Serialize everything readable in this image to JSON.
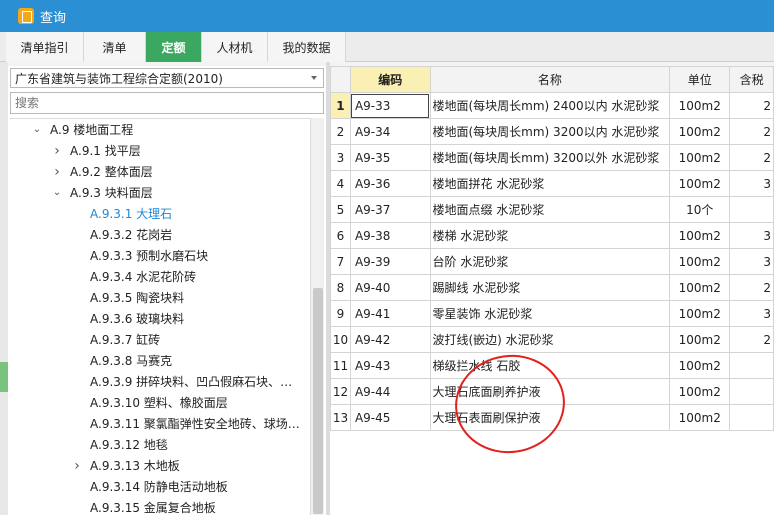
{
  "window": {
    "title": "查询"
  },
  "tabs": [
    {
      "label": "清单指引",
      "active": false
    },
    {
      "label": "清单",
      "active": false
    },
    {
      "label": "定额",
      "active": true
    },
    {
      "label": "人材机",
      "active": false
    },
    {
      "label": "我的数据",
      "active": false
    }
  ],
  "left_panel": {
    "quota_library": "广东省建筑与装饰工程综合定额(2010)",
    "search_placeholder": "搜索",
    "tree": [
      {
        "label": "A.9  楼地面工程",
        "indent": 0,
        "expander": "expanded"
      },
      {
        "label": "A.9.1 找平层",
        "indent": 1,
        "expander": "collapsed"
      },
      {
        "label": "A.9.2 整体面层",
        "indent": 1,
        "expander": "collapsed"
      },
      {
        "label": "A.9.3 块料面层",
        "indent": 1,
        "expander": "expanded"
      },
      {
        "label": "A.9.3.1 大理石",
        "indent": 2,
        "expander": "none",
        "selected": true
      },
      {
        "label": "A.9.3.2 花岗岩",
        "indent": 2,
        "expander": "none"
      },
      {
        "label": "A.9.3.3 预制水磨石块",
        "indent": 2,
        "expander": "none"
      },
      {
        "label": "A.9.3.4 水泥花阶砖",
        "indent": 2,
        "expander": "none"
      },
      {
        "label": "A.9.3.5 陶瓷块料",
        "indent": 2,
        "expander": "none"
      },
      {
        "label": "A.9.3.6 玻璃块料",
        "indent": 2,
        "expander": "none"
      },
      {
        "label": "A.9.3.7 缸砖",
        "indent": 2,
        "expander": "none"
      },
      {
        "label": "A.9.3.8 马赛克",
        "indent": 2,
        "expander": "none"
      },
      {
        "label": "A.9.3.9 拼碎块料、凹凸假麻石块、…",
        "indent": 2,
        "expander": "none"
      },
      {
        "label": "A.9.3.10 塑料、橡胶面层",
        "indent": 2,
        "expander": "none"
      },
      {
        "label": "A.9.3.11 聚氯酯弹性安全地砖、球场…",
        "indent": 2,
        "expander": "none"
      },
      {
        "label": "A.9.3.12 地毯",
        "indent": 2,
        "expander": "none"
      },
      {
        "label": "A.9.3.13 木地板",
        "indent": 2,
        "expander": "collapsed"
      },
      {
        "label": "A.9.3.14 防静电活动地板",
        "indent": 2,
        "expander": "none"
      },
      {
        "label": "A.9.3.15 金属复合地板",
        "indent": 2,
        "expander": "none"
      }
    ]
  },
  "grid": {
    "columns": [
      "",
      "编码",
      "名称",
      "单位",
      "含税"
    ],
    "rows": [
      {
        "num": "1",
        "code": "A9-33",
        "name": "楼地面(每块周长mm) 2400以内 水泥砂浆",
        "unit": "100m2",
        "price": "2"
      },
      {
        "num": "2",
        "code": "A9-34",
        "name": "楼地面(每块周长mm) 3200以内 水泥砂浆",
        "unit": "100m2",
        "price": "2"
      },
      {
        "num": "3",
        "code": "A9-35",
        "name": "楼地面(每块周长mm) 3200以外 水泥砂浆",
        "unit": "100m2",
        "price": "2"
      },
      {
        "num": "4",
        "code": "A9-36",
        "name": "楼地面拼花 水泥砂浆",
        "unit": "100m2",
        "price": "3"
      },
      {
        "num": "5",
        "code": "A9-37",
        "name": "楼地面点缀 水泥砂浆",
        "unit": "10个",
        "price": ""
      },
      {
        "num": "6",
        "code": "A9-38",
        "name": "楼梯 水泥砂浆",
        "unit": "100m2",
        "price": "3"
      },
      {
        "num": "7",
        "code": "A9-39",
        "name": "台阶 水泥砂浆",
        "unit": "100m2",
        "price": "3"
      },
      {
        "num": "8",
        "code": "A9-40",
        "name": "踢脚线 水泥砂浆",
        "unit": "100m2",
        "price": "2"
      },
      {
        "num": "9",
        "code": "A9-41",
        "name": "零星装饰 水泥砂浆",
        "unit": "100m2",
        "price": "3"
      },
      {
        "num": "10",
        "code": "A9-42",
        "name": "波打线(嵌边) 水泥砂浆",
        "unit": "100m2",
        "price": "2"
      },
      {
        "num": "11",
        "code": "A9-43",
        "name": "梯级拦水线 石胶",
        "unit": "100m2",
        "price": ""
      },
      {
        "num": "12",
        "code": "A9-44",
        "name": "大理石底面刷养护液",
        "unit": "100m2",
        "price": ""
      },
      {
        "num": "13",
        "code": "A9-45",
        "name": "大理石表面刷保护液",
        "unit": "100m2",
        "price": ""
      }
    ]
  },
  "colors": {
    "titlebar": "#2b8fd4",
    "active_tab": "#3aa860",
    "header_highlight": "#fbf0b4",
    "annotation": "#e2201c",
    "selected_tree": "#1e88d8"
  },
  "icons": {
    "app": "query-app-icon",
    "tree_expanded": "chevron-down-icon",
    "tree_collapsed": "chevron-right-icon",
    "dropdown": "caret-down-icon"
  }
}
